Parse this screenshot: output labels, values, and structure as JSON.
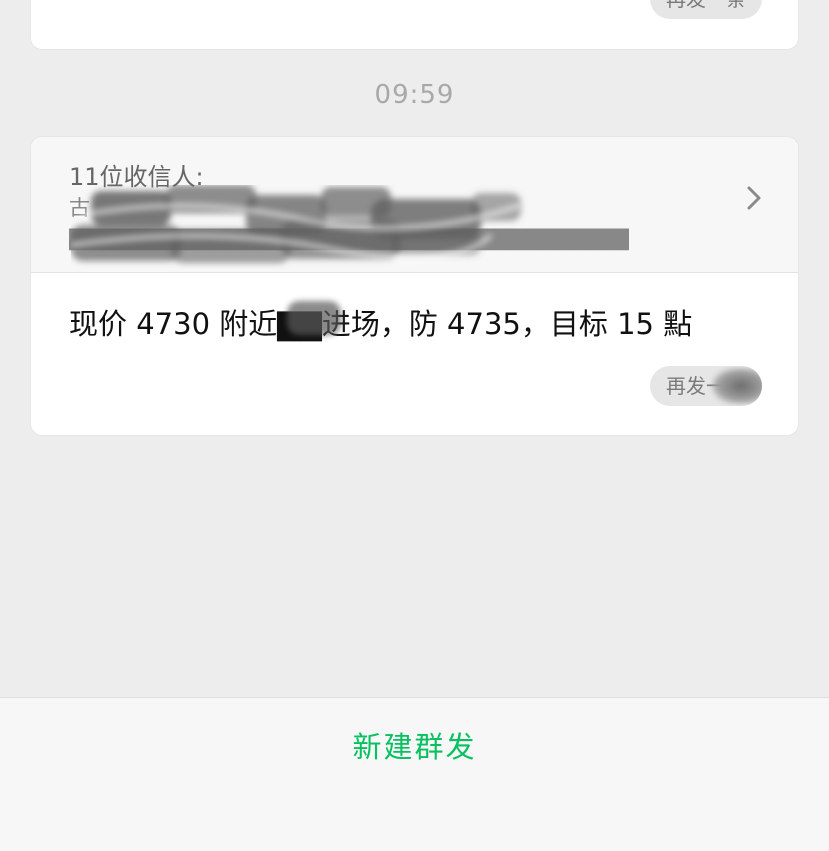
{
  "top_card": {
    "resend_label": "再发一条"
  },
  "timestamp": "09:59",
  "main_card": {
    "recipients_label": "11位收信人:",
    "recipients_list": "古▇▇▇▇▇▇▇▇▇▇▇▇▇▇▇▇▇▇▇▇▇▇▇▇▇▇▇▇▇▇▇▇▇▇▇▇▇▇▇▇…",
    "message": "现价 4730 附近▇▇进场，防 4735，目标 15 點",
    "resend_label": "再发一条"
  },
  "bottom_bar": {
    "new_broadcast_label": "新建群发"
  },
  "colors": {
    "background": "#ededed",
    "card": "#ffffff",
    "accent_green": "#07c160",
    "timestamp_gray": "#a8a8a8"
  },
  "icons": {
    "recipients_chevron": "chevron-right-icon"
  }
}
